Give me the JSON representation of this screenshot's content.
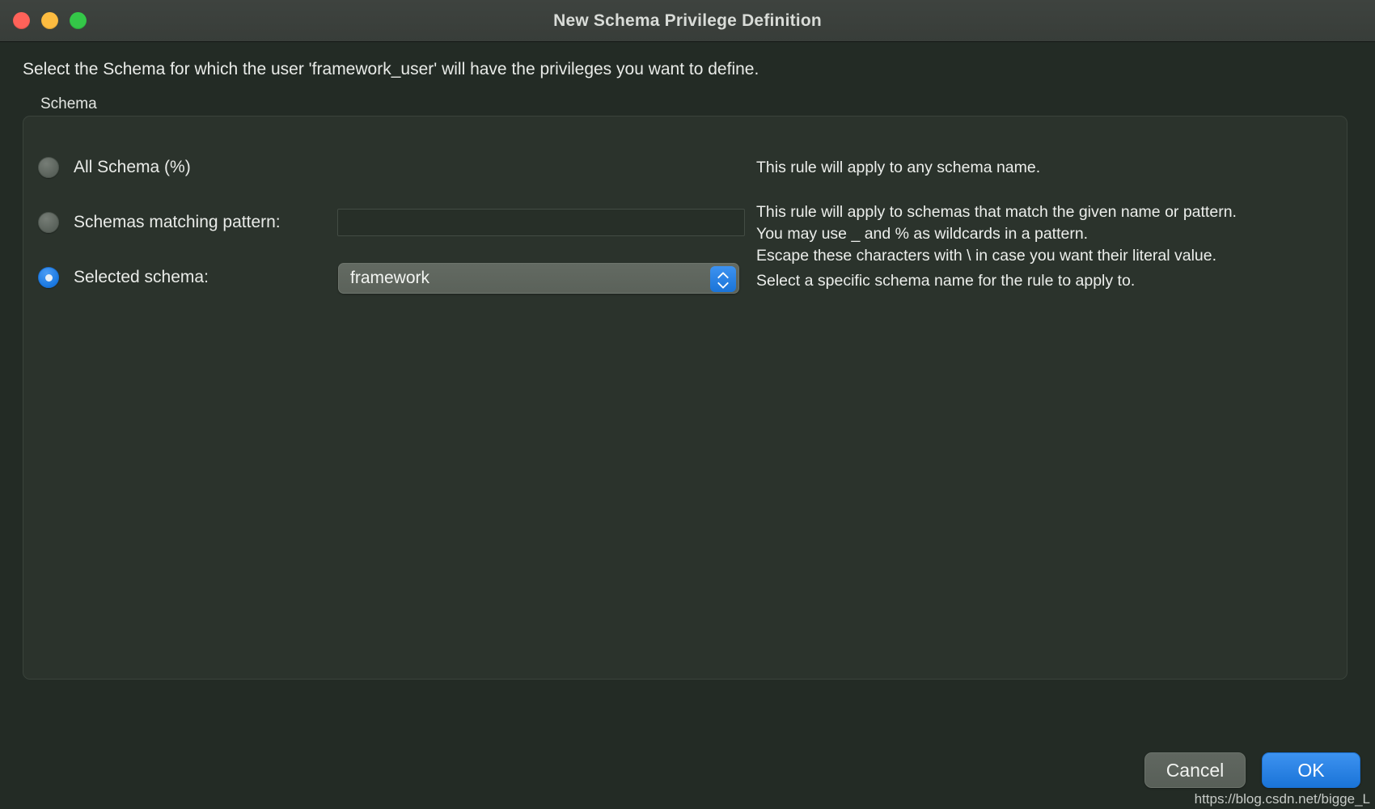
{
  "window": {
    "title": "New Schema Privilege Definition",
    "traffic_lights": [
      {
        "name": "close",
        "color": "#ff6259"
      },
      {
        "name": "minimize",
        "color": "#fdbc40"
      },
      {
        "name": "zoom",
        "color": "#34c748"
      }
    ]
  },
  "intro_text": "Select the Schema for which the user 'framework_user' will have the privileges you want to define.",
  "group": {
    "label": "Schema",
    "options": [
      {
        "id": "all-schema",
        "label": "All Schema (%)",
        "selected": false,
        "hint": "This rule will apply to any schema name."
      },
      {
        "id": "schemas-matching-pattern",
        "label": "Schemas matching pattern:",
        "selected": false,
        "hint": "This rule will apply to schemas that match the given name or pattern.\nYou may use _ and % as wildcards in a pattern.\nEscape these characters with \\ in case you want their literal value.",
        "input": {
          "value": "",
          "placeholder": ""
        }
      },
      {
        "id": "selected-schema",
        "label": "Selected schema:",
        "selected": true,
        "hint": "Select a specific schema name for the rule to apply to.",
        "select": {
          "value": "framework",
          "options": [
            "framework"
          ]
        }
      }
    ]
  },
  "footer": {
    "cancel_label": "Cancel",
    "ok_label": "OK",
    "accent_color": "#1a74d8"
  },
  "watermark": "https://blog.csdn.net/bigge_L"
}
